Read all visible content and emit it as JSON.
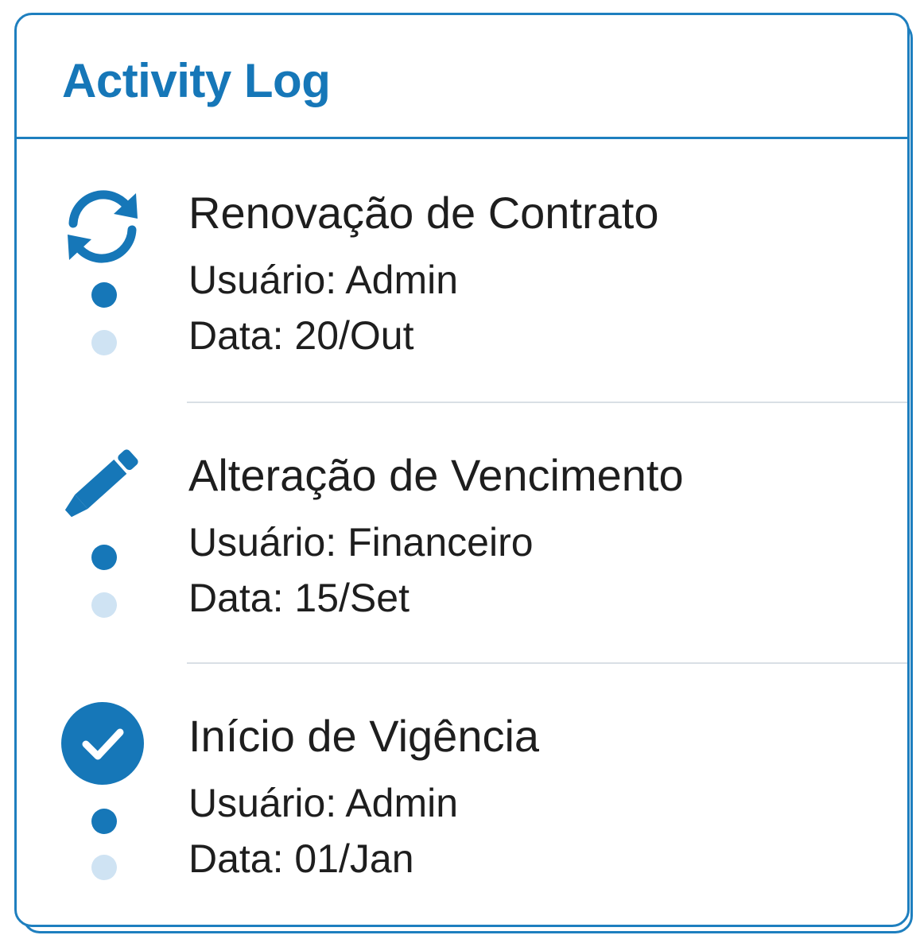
{
  "header": {
    "title": "Activity Log"
  },
  "entries": [
    {
      "icon": "refresh-icon",
      "title": "Renovação de Contrato",
      "user": "Usuário: Admin",
      "date": "Data: 20/Out"
    },
    {
      "icon": "pencil-icon",
      "title": "Alteração de Vencimento",
      "user": "Usuário: Financeiro",
      "date": "Data: 15/Set"
    },
    {
      "icon": "check-circle-icon",
      "title": "Início de Vigência",
      "user": "Usuário: Admin",
      "date": "Data: 01/Jan"
    }
  ],
  "colors": {
    "accent": "#1677b8",
    "dot_faint": "#cfe3f3",
    "text": "#1e1e1e",
    "divider": "#d9dfe5"
  }
}
